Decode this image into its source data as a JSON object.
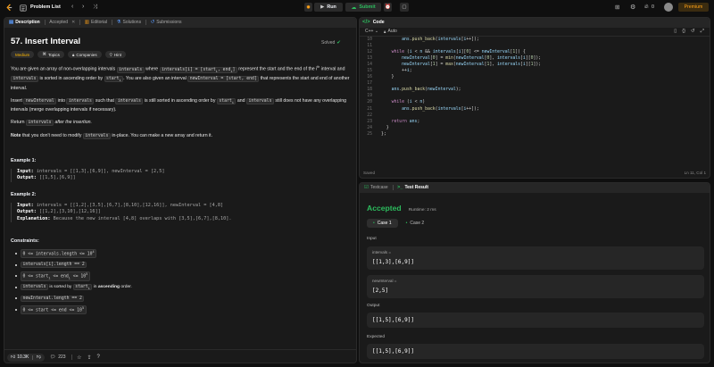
{
  "topbar": {
    "problem_list": "Problem List",
    "run": "Run",
    "submit": "Submit",
    "fire_count": "0",
    "premium": "Premium"
  },
  "left_tabs": {
    "description": "Description",
    "accepted": "Accepted",
    "editorial": "Editorial",
    "solutions": "Solutions",
    "submissions": "Submissions"
  },
  "problem": {
    "title": "57. Insert Interval",
    "solved": "Solved",
    "difficulty": "Medium",
    "topics": "Topics",
    "companies": "Companies",
    "hint": "Hint",
    "p1_a": "You are given an array of non-overlapping intervals ",
    "p1_code1": "intervals",
    "p1_b": " where ",
    "p1_code2": "intervals[i] = [start",
    "p1_c": " represent the start and the end of the",
    "p1_d": " interval and ",
    "p1_code3": "intervals",
    "p1_e": " is sorted in ascending order by ",
    "p1_code4": "start",
    "p1_f": ". You are also given an interval ",
    "p1_code5": "newInterval = [start, end]",
    "p1_g": " that represents the start and end of another interval.",
    "p2_a": "Insert ",
    "p2_code1": "newInterval",
    "p2_b": " into ",
    "p2_code2": "intervals",
    "p2_c": " such that ",
    "p2_code3": "intervals",
    "p2_d": " is still sorted in ascending order by ",
    "p2_code4": "start",
    "p2_e": " and ",
    "p2_code5": "intervals",
    "p2_f": " still does not have any overlapping intervals (merge overlapping intervals if necessary).",
    "p3_a": "Return ",
    "p3_code": "intervals",
    "p3_b": " after the insertion.",
    "p4_bold": "Note",
    "p4_a": " that you don't need to modify ",
    "p4_code": "intervals",
    "p4_b": " in-place. You can make a new array and return it.",
    "ex1_title": "Example 1:",
    "ex1_input_label": "Input:",
    "ex1_input": " intervals = [[1,3],[6,9]], newInterval = [2,5]",
    "ex1_output_label": "Output:",
    "ex1_output": " [[1,5],[6,9]]",
    "ex2_title": "Example 2:",
    "ex2_input_label": "Input:",
    "ex2_input": " intervals = [[1,2],[3,5],[6,7],[8,10],[12,16]], newInterval = [4,8]",
    "ex2_output_label": "Output:",
    "ex2_output": " [[1,2],[3,10],[12,16]]",
    "ex2_expl_label": "Explanation:",
    "ex2_expl": " Because the new interval [4,8] overlaps with [3,5],[6,7],[8,10].",
    "constraints_title": "Constraints:",
    "c1": "0 <= intervals.length <= 10",
    "c1_sup": "4",
    "c2": "intervals[i].length == 2",
    "c3": "0 <= start",
    "c3_b": " <= end",
    "c3_c": " <= 10",
    "c3_sup": "5",
    "c4_code": "intervals",
    "c4_a": " is sorted by ",
    "c4_code2": "start",
    "c4_b": " in ",
    "c4_bold": "ascending",
    "c4_c": " order.",
    "c5": "newInterval.length == 2",
    "c6": "0 <= start <= end <= 10",
    "c6_sup": "5"
  },
  "footer": {
    "likes": "10.3K",
    "comments": "223"
  },
  "code_panel": {
    "title": "Code",
    "lang": "C++",
    "auto": "Auto",
    "saved": "Saved",
    "cursor": "Ln 11, Col 1",
    "lines": [
      {
        "n": "10",
        "t": "        ans.push_back(intervals[i++]);"
      },
      {
        "n": "11",
        "t": ""
      },
      {
        "n": "12",
        "t": "    while (i < n && intervals[i][0] <= newInterval[1]) {"
      },
      {
        "n": "13",
        "t": "        newInterval[0] = min(newInterval[0], intervals[i][0]);"
      },
      {
        "n": "14",
        "t": "        newInterval[1] = max(newInterval[1], intervals[i][1]);"
      },
      {
        "n": "15",
        "t": "        ++i;"
      },
      {
        "n": "16",
        "t": "    }"
      },
      {
        "n": "17",
        "t": ""
      },
      {
        "n": "18",
        "t": "    ans.push_back(newInterval);"
      },
      {
        "n": "19",
        "t": ""
      },
      {
        "n": "20",
        "t": "    while (i < n)"
      },
      {
        "n": "21",
        "t": "        ans.push_back(intervals[i++]);"
      },
      {
        "n": "22",
        "t": ""
      },
      {
        "n": "23",
        "t": "    return ans;"
      },
      {
        "n": "24",
        "t": "  }"
      },
      {
        "n": "25",
        "t": "};"
      }
    ]
  },
  "result_panel": {
    "tab_testcase": "Testcase",
    "tab_result": "Test Result",
    "status": "Accepted",
    "runtime": "Runtime: 2 ms",
    "case1": "Case 1",
    "case2": "Case 2",
    "input_label": "Input",
    "var1_name": "intervals =",
    "var1_value": "[[1,3],[6,9]]",
    "var2_name": "newInterval =",
    "var2_value": "[2,5]",
    "output_label": "Output",
    "output_value": "[[1,5],[6,9]]",
    "expected_label": "Expected",
    "expected_value": "[[1,5],[6,9]]"
  },
  "colors": {
    "accent_orange": "#ffa116",
    "green": "#2cbb5d",
    "medium": "#ffb800"
  }
}
